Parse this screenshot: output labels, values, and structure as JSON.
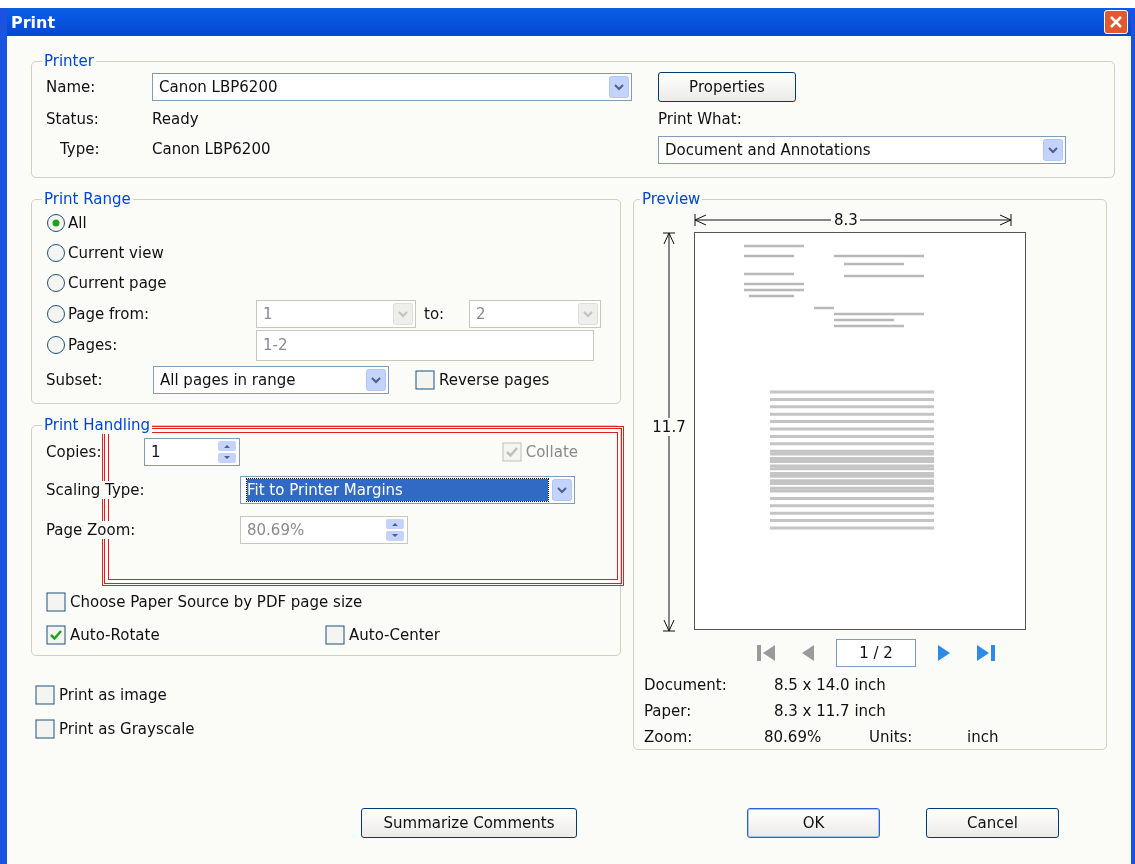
{
  "window": {
    "title": "Print"
  },
  "printer": {
    "group_label": "Printer",
    "name": {
      "label": "Name:",
      "value": "Canon LBP6200"
    },
    "status": {
      "label": "Status:",
      "value": "Ready"
    },
    "type": {
      "label": "Type:",
      "value": "Canon LBP6200"
    },
    "properties_button": "Properties",
    "print_what": {
      "label": "Print What:",
      "value": "Document and Annotations"
    }
  },
  "print_range": {
    "group_label": "Print Range",
    "options": [
      {
        "label": "All",
        "selected": true
      },
      {
        "label": "Current view",
        "selected": false
      },
      {
        "label": "Current page",
        "selected": false
      },
      {
        "label": "Page from:",
        "selected": false
      },
      {
        "label": "Pages:",
        "selected": false
      }
    ],
    "page_from": {
      "value": "1",
      "disabled": true
    },
    "to_label": "to:",
    "page_to": {
      "value": "2",
      "disabled": true
    },
    "pages_field": {
      "value": "1-2",
      "disabled": true
    },
    "subset": {
      "label": "Subset:",
      "value": "All pages in range"
    },
    "reverse_pages": {
      "label": "Reverse pages",
      "checked": false
    }
  },
  "print_handling": {
    "group_label": "Print Handling",
    "copies": {
      "label": "Copies:",
      "value": "1"
    },
    "collate": {
      "label": "Collate",
      "checked": true,
      "disabled": true
    },
    "scaling_type": {
      "label": "Scaling Type:",
      "value": "Fit to Printer Margins",
      "focused": true
    },
    "page_zoom": {
      "label": "Page Zoom:",
      "value": "80.69%",
      "disabled": true
    },
    "checkboxes": [
      {
        "label": "Choose Paper Source by PDF page size",
        "checked": false
      },
      {
        "label": "Auto-Rotate",
        "checked": true
      },
      {
        "label": "Auto-Center",
        "checked": false
      }
    ]
  },
  "options": [
    {
      "label": "Print as image",
      "checked": false
    },
    {
      "label": "Print as Grayscale",
      "checked": false
    }
  ],
  "preview": {
    "group_label": "Preview",
    "width_label": "8.3",
    "height_label": "11.7",
    "navigation": [
      {
        "kind": "first",
        "disabled": true
      },
      {
        "kind": "previous",
        "disabled": true
      },
      {
        "kind": "next",
        "disabled": false
      },
      {
        "kind": "last",
        "disabled": false
      }
    ],
    "page_field": "1 / 2",
    "info": [
      {
        "label": "Document:",
        "value": "8.5 x 14.0 inch"
      },
      {
        "label": "Paper:",
        "value": "8.3 x 11.7 inch"
      }
    ],
    "zoom": {
      "label": "Zoom:",
      "value": "80.69%"
    },
    "units": {
      "label": "Units:",
      "value": "inch"
    }
  },
  "buttons": [
    {
      "label": "Summarize Comments",
      "default": false
    },
    {
      "label": "OK",
      "default": true
    },
    {
      "label": "Cancel",
      "default": false
    }
  ]
}
